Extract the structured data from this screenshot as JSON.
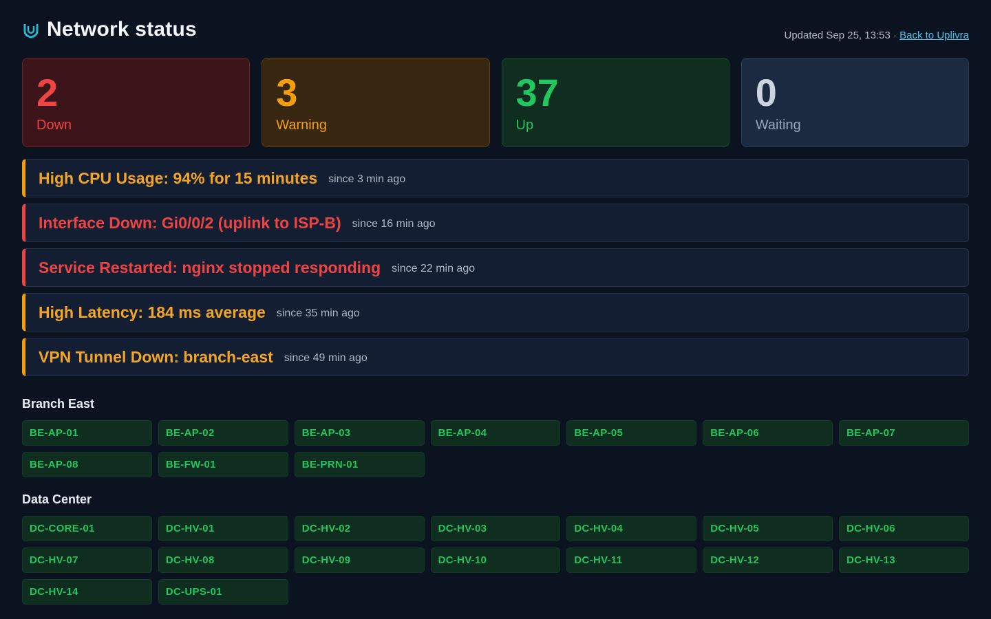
{
  "header": {
    "title": "Network status",
    "logo_icon": "shield-logo-icon",
    "updated": "Updated Sep 25, 13:53 · ",
    "back_link": "Back to Uplivra"
  },
  "colors": {
    "background": "#0b1220",
    "down": "#ef4444",
    "warning": "#f59e0b",
    "up": "#22c55e",
    "waiting": "#cbd5e1",
    "link": "#4fc3e8"
  },
  "summary": {
    "down": {
      "count": "2",
      "label": "Down"
    },
    "warning": {
      "count": "3",
      "label": "Warning"
    },
    "up": {
      "count": "37",
      "label": "Up"
    },
    "waiting": {
      "count": "0",
      "label": "Waiting"
    }
  },
  "alerts": [
    {
      "title": "High CPU Usage: 94% for 15 minutes",
      "since": "since 3 min ago",
      "severity": "warning"
    },
    {
      "title": "Interface Down: Gi0/0/2 (uplink to ISP-B)",
      "since": "since 16 min ago",
      "severity": "down"
    },
    {
      "title": "Service Restarted: nginx stopped responding",
      "since": "since 22 min ago",
      "severity": "down"
    },
    {
      "title": "High Latency: 184 ms average",
      "since": "since 35 min ago",
      "severity": "warning"
    },
    {
      "title": "VPN Tunnel Down: branch-east",
      "since": "since 49 min ago",
      "severity": "warning"
    }
  ],
  "groups": [
    {
      "name": "Branch East",
      "devices": [
        "BE-AP-01",
        "BE-AP-02",
        "BE-AP-03",
        "BE-AP-04",
        "BE-AP-05",
        "BE-AP-06",
        "BE-AP-07",
        "BE-AP-08",
        "BE-FW-01",
        "BE-PRN-01"
      ]
    },
    {
      "name": "Data Center",
      "devices": [
        "DC-CORE-01",
        "DC-HV-01",
        "DC-HV-02",
        "DC-HV-03",
        "DC-HV-04",
        "DC-HV-05",
        "DC-HV-06",
        "DC-HV-07",
        "DC-HV-08",
        "DC-HV-09",
        "DC-HV-10",
        "DC-HV-11",
        "DC-HV-12",
        "DC-HV-13",
        "DC-HV-14",
        "DC-UPS-01"
      ]
    }
  ]
}
